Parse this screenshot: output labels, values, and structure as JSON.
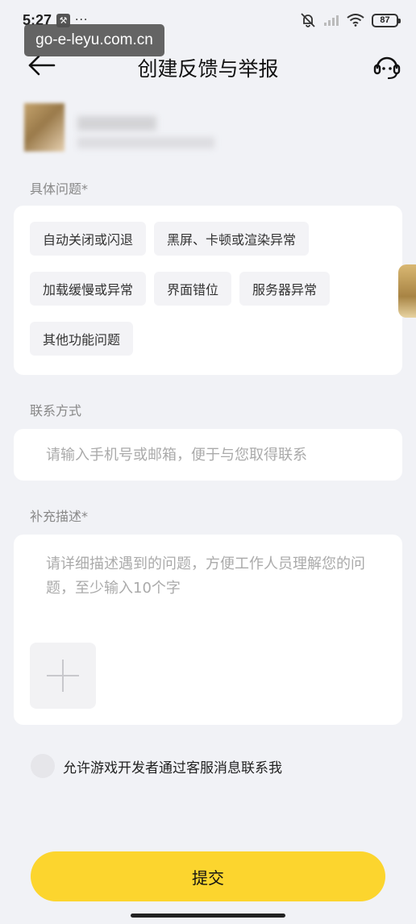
{
  "status_bar": {
    "time": "5:27",
    "wrench_icon": "wrench-icon",
    "more_indicator": "···",
    "battery": "87"
  },
  "watermark": "go-e-leyu.com.cn",
  "header": {
    "title": "创建反馈与举报",
    "back_icon": "arrow-left-icon",
    "service_icon": "customer-service-icon"
  },
  "issue_section": {
    "label": "具体问题*",
    "rows": [
      [
        "自动关闭或闪退",
        "黑屏、卡顿或渲染异常"
      ],
      [
        "加载缓慢或异常",
        "界面错位",
        "服务器异常"
      ],
      [
        "其他功能问题"
      ]
    ]
  },
  "contact_section": {
    "label": "联系方式",
    "placeholder": "请输入手机号或邮箱，便于与您取得联系",
    "value": ""
  },
  "description_section": {
    "label": "补充描述*",
    "placeholder": "请详细描述遇到的问题，方便工作人员理解您的问题，至少输入10个字",
    "value": "",
    "add_image_icon": "plus-icon"
  },
  "consent": {
    "label": "允许游戏开发者通过客服消息联系我",
    "checked": false
  },
  "submit_label": "提交",
  "colors": {
    "accent": "#fcd52e",
    "background": "#f1f2f6",
    "card": "#ffffff",
    "chip": "#f3f3f6"
  }
}
